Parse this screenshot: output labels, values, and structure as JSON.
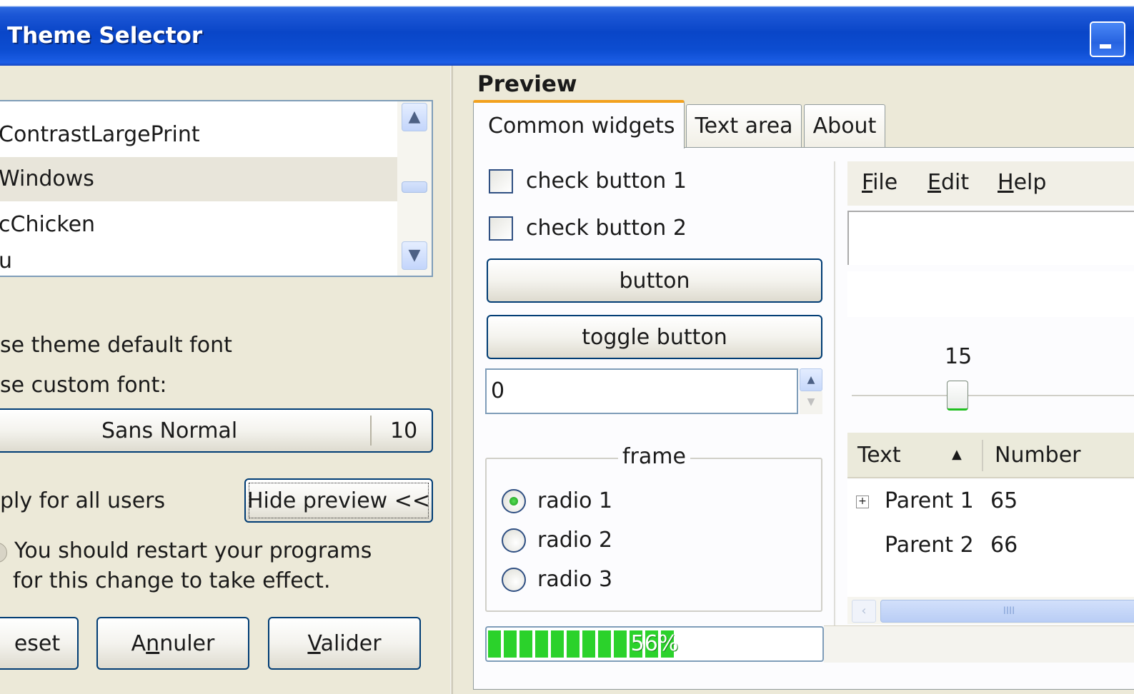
{
  "window": {
    "title": "Theme Selector"
  },
  "themes": {
    "items": [
      "ContrastLargePrint",
      "Windows",
      "cChicken",
      "u"
    ]
  },
  "font": {
    "default_option": "se theme default font",
    "custom_option": "se custom font:",
    "font_name": "Sans Normal",
    "font_size": "10"
  },
  "apply": {
    "all_users_label": "ply for all users",
    "hide_preview_label": "Hide preview <<",
    "restart_line1": "You should restart your programs",
    "restart_line2": "for this change to take effect."
  },
  "actions": {
    "reset_label": "eset",
    "cancel_label": "Annuler",
    "validate_label": "Valider"
  },
  "preview": {
    "heading": "Preview",
    "tabs": [
      "Common widgets",
      "Text area",
      "About"
    ],
    "check1": "check button 1",
    "check2": "check button 2",
    "button": "button",
    "toggle": "toggle button",
    "spin_value": "0",
    "frame_label": "frame",
    "radios": [
      "radio 1",
      "radio 2",
      "radio 3"
    ],
    "radio_selected": 0,
    "progress": 0.56,
    "progress_label": "56%",
    "menu": [
      "File",
      "Edit",
      "Help"
    ],
    "scale_value": "15",
    "tree_columns": [
      "Text",
      "Number"
    ],
    "tree_rows": [
      {
        "text": "Parent 1",
        "number": "65"
      },
      {
        "text": "Parent 2",
        "number": "66"
      }
    ]
  }
}
